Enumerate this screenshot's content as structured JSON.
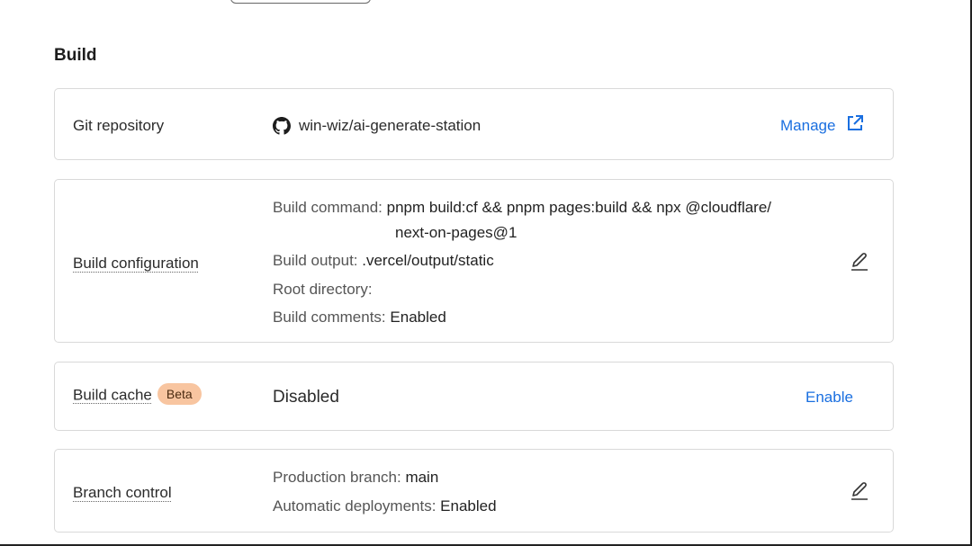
{
  "section": {
    "title": "Build"
  },
  "git": {
    "label": "Git repository",
    "repo": "win-wiz/ai-generate-station",
    "manage_label": "Manage",
    "icons": {
      "repo": "github-icon",
      "manage": "external-link-icon"
    }
  },
  "build_config": {
    "label": "Build configuration",
    "command_key": "Build command:",
    "command_value_line1": "pnpm build:cf && pnpm pages:build && npx @cloudflare/",
    "command_value_line2": "next-on-pages@1",
    "output_key": "Build output:",
    "output_value": ".vercel/output/static",
    "root_key": "Root directory:",
    "root_value": "",
    "comments_key": "Build comments:",
    "comments_value": "Enabled",
    "edit_icon": "pencil-icon"
  },
  "build_cache": {
    "label": "Build cache",
    "badge": "Beta",
    "status": "Disabled",
    "enable_label": "Enable"
  },
  "branch_control": {
    "label": "Branch control",
    "production_key": "Production branch:",
    "production_value": "main",
    "auto_key": "Automatic deployments:",
    "auto_value": "Enabled",
    "edit_icon": "pencil-icon"
  },
  "colors": {
    "link": "#1a6fe0",
    "badge_bg": "#f8c5a0",
    "border": "#d9d9d9"
  }
}
